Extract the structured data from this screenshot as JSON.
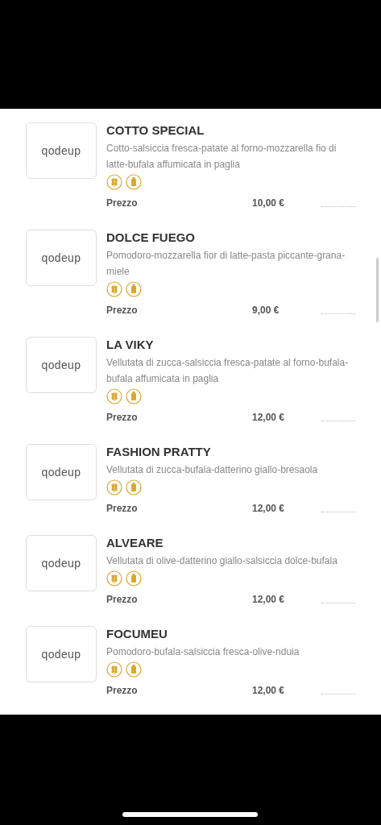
{
  "items": [
    {
      "logo": "qodeup",
      "name": "COTTO SPECIAL",
      "description": "Cotto-salsiccia fresca-patate al forno-mozzarella fio di latte-bufala affumicata in paglia",
      "price_label": "Prezzo",
      "price": "10,00 €"
    },
    {
      "logo": "qodeup",
      "name": "DOLCE FUEGO",
      "description": "Pomodoro-mozzarella fior di latte-pasta piccante-grana-miele",
      "price_label": "Prezzo",
      "price": "9,00 €"
    },
    {
      "logo": "qodeup",
      "name": "LA VIKY",
      "description": "Vellutata di zucca-salsiccia fresca-patate al forno-bufala-bufala affumicata in paglia",
      "price_label": "Prezzo",
      "price": "12,00 €"
    },
    {
      "logo": "qodeup",
      "name": "FASHION PRATTY",
      "description": "Vellutata di zucca-bufala-datterino giallo-bresaola",
      "price_label": "Prezzo",
      "price": "12,00 €"
    },
    {
      "logo": "qodeup",
      "name": "ALVEARE",
      "description": "Vellutata di olive-datterino giallo-salsiccia dolce-bufala",
      "price_label": "Prezzo",
      "price": "12,00 €"
    },
    {
      "logo": "qodeup",
      "name": "FOCUMEU",
      "description": "Pomodoro-bufala-salsiccia fresca-olive-nduia",
      "price_label": "Prezzo",
      "price": "12,00 €"
    }
  ]
}
